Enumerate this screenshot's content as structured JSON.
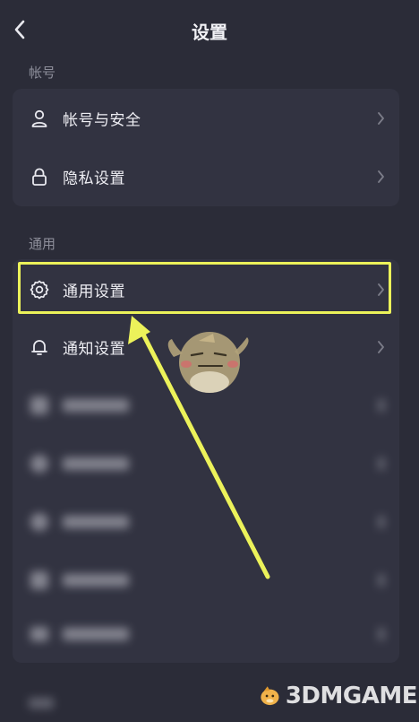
{
  "header": {
    "title": "设置"
  },
  "sections": {
    "account": {
      "label": "帐号"
    },
    "general": {
      "label": "通用"
    },
    "bottom": {
      "label": ""
    }
  },
  "rows": {
    "account_security": {
      "label": "帐号与安全",
      "icon": "user-icon"
    },
    "privacy": {
      "label": "隐私设置",
      "icon": "lock-icon"
    },
    "general_settings": {
      "label": "通用设置",
      "icon": "gear-icon"
    },
    "notifications": {
      "label": "通知设置",
      "icon": "bell-icon"
    }
  },
  "annotation": {
    "highlight_color": "#ecf25a"
  },
  "watermark": {
    "text": "3DMGAME"
  },
  "colors": {
    "background": "#2b2c38",
    "card": "#323341",
    "accent": "#ecf25a"
  }
}
